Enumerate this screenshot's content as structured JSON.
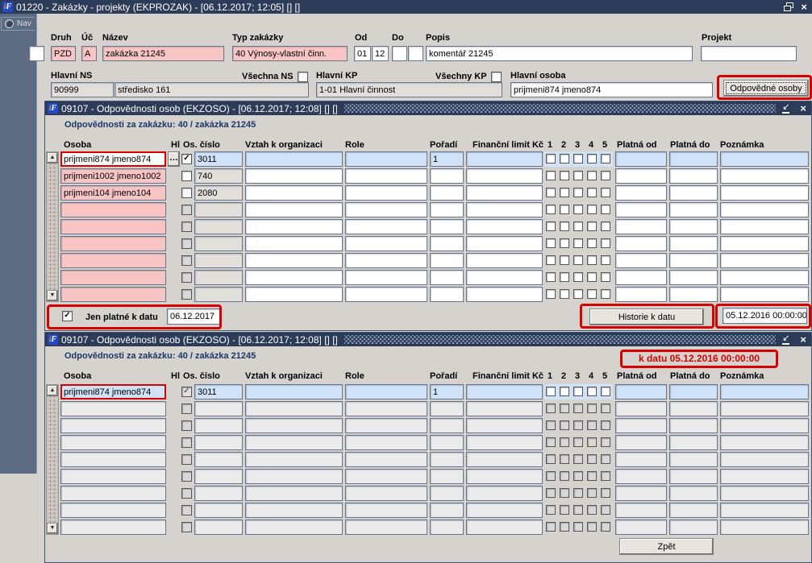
{
  "colors": {
    "titlebar": "#2c3b57",
    "window_bg": "#d6d3ce",
    "field_pink": "#f9c4c4",
    "field_blue": "#cfe2f7",
    "annotation_red": "#d90000"
  },
  "icons": {
    "app": "ifis-logo",
    "check": "✓",
    "dots": "…",
    "close": "×",
    "collapse": "↙",
    "scroll_up": "▲",
    "scroll_down": "▼"
  },
  "nav": {
    "label": "Nav"
  },
  "main_window": {
    "title": "01220 - Zakázky - projekty (EKPROZAK) - [06.12.2017; 12:05] [] []"
  },
  "form": {
    "druh": {
      "label": "Druh",
      "value": "PZD"
    },
    "uc": {
      "label": "Úč",
      "value": "A"
    },
    "nazev": {
      "label": "Název",
      "value": "zakázka 21245"
    },
    "typ": {
      "label": "Typ zakázky",
      "value": "40 Výnosy-vlastní činn."
    },
    "od": {
      "label": "Od",
      "v1": "01",
      "v2": "12"
    },
    "do": {
      "label": "Do",
      "v1": "",
      "v2": ""
    },
    "popis": {
      "label": "Popis",
      "value": "komentář 21245"
    },
    "projekt": {
      "label": "Projekt",
      "value": ""
    },
    "hlavni_ns": {
      "label": "Hlavní NS",
      "code": "90999",
      "name": "středisko 161"
    },
    "vsechna_ns": {
      "label": "Všechna NS",
      "checked": false
    },
    "hlavni_kp": {
      "label": "Hlavní KP",
      "value": "1-01 Hlavní činnost"
    },
    "vsechny_kp": {
      "label": "Všechny KP",
      "checked": false
    },
    "hlavni_osoba": {
      "label": "Hlavní osoba",
      "value": "prijmeni874 jmeno874"
    },
    "odpovedne_osoby_button": "Odpovědné osoby"
  },
  "window2": {
    "title": "09107 - Odpovědnosti osob (EKZOSO) - [06.12.2017; 12:08] [] []",
    "subtitle": "Odpovědnosti za zakázku: 40 / zakázka 21245",
    "columns": {
      "osoba": "Osoba",
      "hl": "Hl",
      "os_cislo": "Os. číslo",
      "vztah": "Vztah k organizaci",
      "role": "Role",
      "poradi": "Pořadí",
      "fin": "Finanční limit Kč",
      "c1": "1",
      "c2": "2",
      "c3": "3",
      "c4": "4",
      "c5": "5",
      "platna_od": "Platná od",
      "platna_do": "Platná do",
      "poznamka": "Poznámka"
    },
    "rows": [
      {
        "state": "current",
        "osoba": "prijmeni874 jmeno874",
        "hl": true,
        "os_cislo": "3011",
        "vztah": "",
        "role": "",
        "poradi": "1",
        "fin_limit": "",
        "flags": [
          false,
          false,
          false,
          false,
          false
        ],
        "platna_od": "",
        "platna_do": "",
        "poznamka": ""
      },
      {
        "state": "filled",
        "osoba": "prijmeni1002 jmeno1002",
        "hl": false,
        "os_cislo": "740",
        "vztah": "",
        "role": "",
        "poradi": "",
        "fin_limit": "",
        "flags": [
          false,
          false,
          false,
          false,
          false
        ],
        "platna_od": "",
        "platna_do": "",
        "poznamka": ""
      },
      {
        "state": "filled",
        "osoba": "prijmeni104 jmeno104",
        "hl": false,
        "os_cislo": "2080",
        "vztah": "",
        "role": "",
        "poradi": "",
        "fin_limit": "",
        "flags": [
          false,
          false,
          false,
          false,
          false
        ],
        "platna_od": "",
        "platna_do": "",
        "poznamka": ""
      },
      {
        "state": "empty"
      },
      {
        "state": "empty"
      },
      {
        "state": "empty"
      },
      {
        "state": "empty"
      },
      {
        "state": "empty"
      },
      {
        "state": "empty"
      }
    ],
    "footer": {
      "jen_platne_label": "Jen platné k datu",
      "jen_platne_checked": true,
      "date_value": "06.12.2017",
      "historie_button": "Historie k datu",
      "historie_date": "05.12.2016 00:00:00"
    }
  },
  "window3": {
    "title": "09107 - Odpovědnosti osob (EKZOSO) - [06.12.2017; 12:08] [] []",
    "subtitle": "Odpovědnosti za zakázku: 40 / zakázka 21245",
    "k_datu": "k datu 05.12.2016 00:00:00",
    "columns": {
      "osoba": "Osoba",
      "hl": "Hl",
      "os_cislo": "Os. číslo",
      "vztah": "Vztah k organizaci",
      "role": "Role",
      "poradi": "Pořadí",
      "fin": "Finanční limit Kč",
      "c1": "1",
      "c2": "2",
      "c3": "3",
      "c4": "4",
      "c5": "5",
      "platna_od": "Platná od",
      "platna_do": "Platná do",
      "poznamka": "Poznámka"
    },
    "rows": [
      {
        "state": "current",
        "osoba": "prijmeni874 jmeno874",
        "hl": true,
        "os_cislo": "3011",
        "vztah": "",
        "role": "",
        "poradi": "1",
        "fin_limit": "",
        "flags": [
          false,
          false,
          false,
          false,
          false
        ],
        "platna_od": "",
        "platna_do": "",
        "poznamka": ""
      },
      {
        "state": "empty"
      },
      {
        "state": "empty"
      },
      {
        "state": "empty"
      },
      {
        "state": "empty"
      },
      {
        "state": "empty"
      },
      {
        "state": "empty"
      },
      {
        "state": "empty"
      },
      {
        "state": "empty"
      }
    ],
    "zpet_button": "Zpět"
  }
}
